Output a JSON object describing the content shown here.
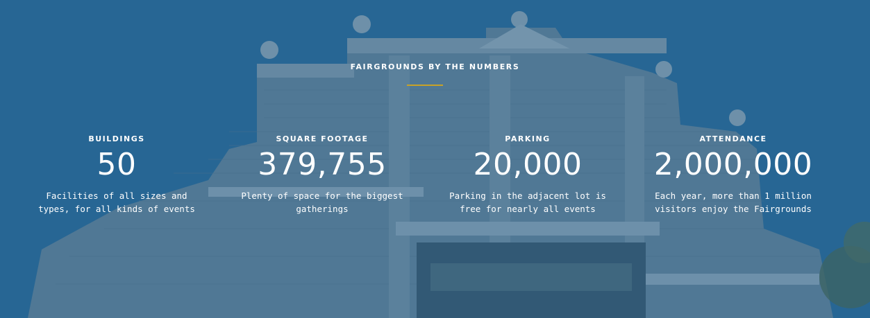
{
  "section": {
    "title": "FAIRGROUNDS BY THE NUMBERS",
    "accent_color": "#c8a227",
    "overlay_color": "#2b628a"
  },
  "stats": [
    {
      "label": "BUILDINGS",
      "value": "50",
      "description": "Facilities of all sizes and types, for all kinds of events"
    },
    {
      "label": "SQUARE FOOTAGE",
      "value": "379,755",
      "description": "Plenty of space for the biggest gatherings"
    },
    {
      "label": "PARKING",
      "value": "20,000",
      "description": "Parking in the adjacent lot is free for nearly all events"
    },
    {
      "label": "ATTENDANCE",
      "value": "2,000,000",
      "description": "Each year, more than 1 million visitors enjoy the Fairgrounds"
    }
  ]
}
